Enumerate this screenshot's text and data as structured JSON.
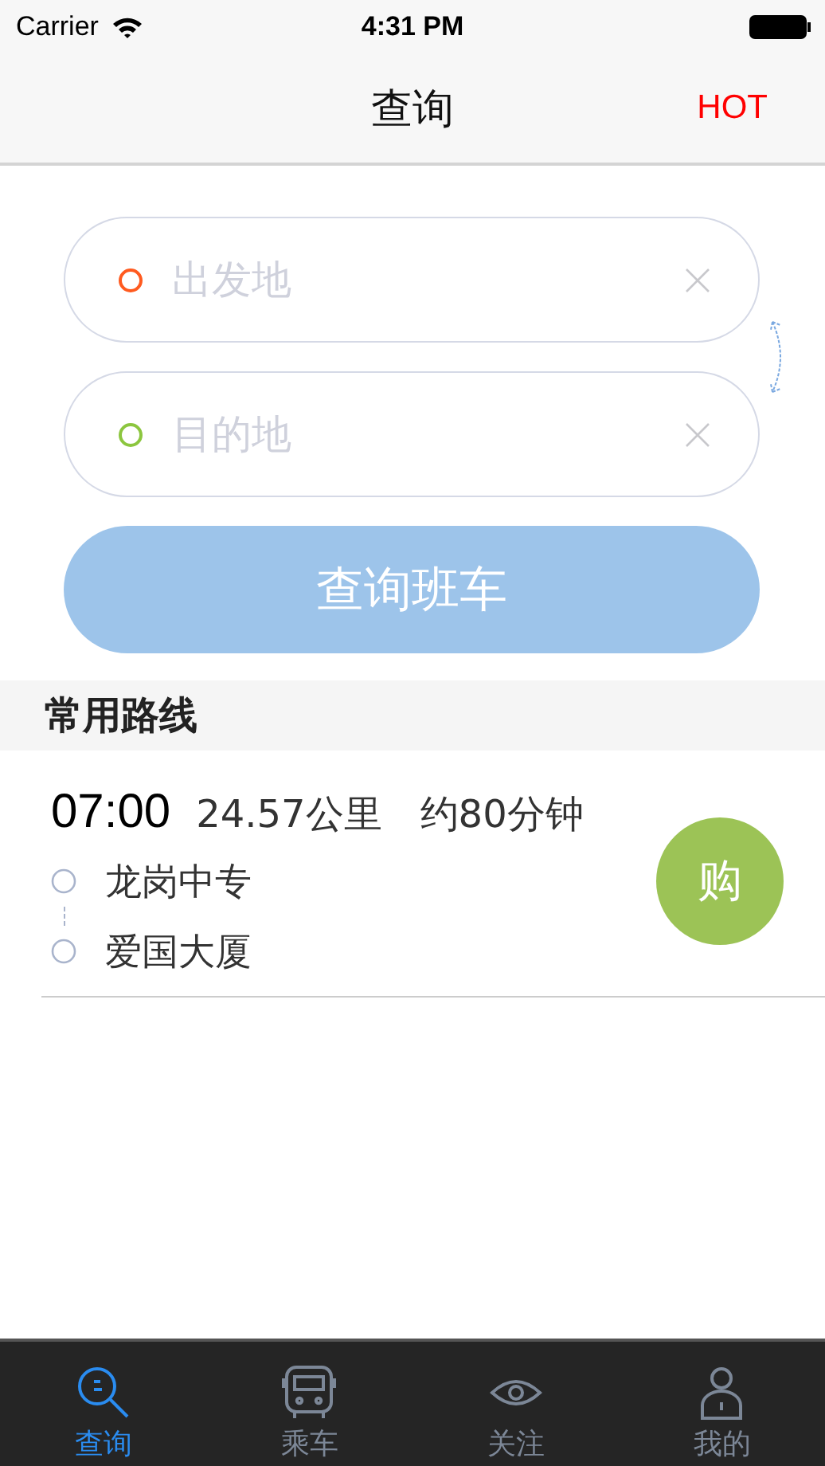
{
  "status_bar": {
    "carrier": "Carrier",
    "time": "4:31 PM"
  },
  "nav": {
    "title": "查询",
    "action": "HOT"
  },
  "fields": [
    {
      "placeholder": "出发地",
      "color": "#ff5a1f"
    },
    {
      "placeholder": "目的地",
      "color": "#8cc63f"
    }
  ],
  "search_button": "查询班车",
  "section_title": "常用路线",
  "routes": [
    {
      "time": "07:00",
      "distance": "24.57公里",
      "duration": "约80分钟",
      "stops": [
        "龙岗中专",
        "爱国大厦"
      ],
      "buy": "购"
    }
  ],
  "tabs": [
    {
      "label": "查询",
      "kind": "search",
      "selected": true
    },
    {
      "label": "乘车",
      "kind": "bus",
      "selected": false
    },
    {
      "label": "关注",
      "kind": "eye",
      "selected": false
    },
    {
      "label": "我的",
      "kind": "person",
      "selected": false
    }
  ]
}
